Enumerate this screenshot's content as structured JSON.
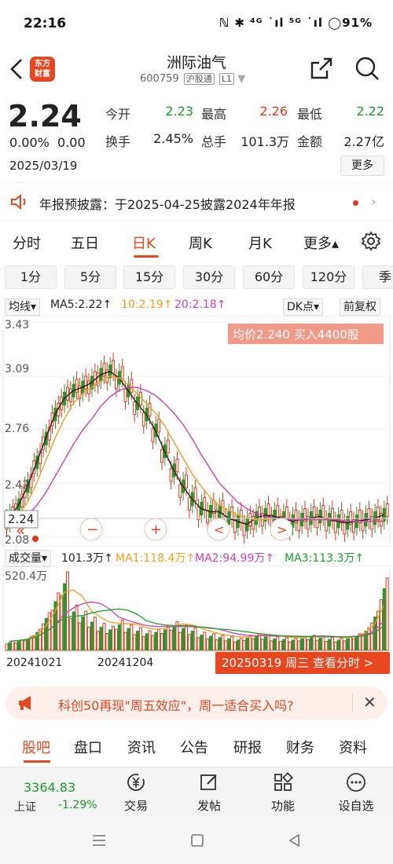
{
  "status": {
    "time": "22:16",
    "battery": "91%",
    "icons": "ℕ ✱ ⁴ᴳ ˙ıl ⁵ᴳ ˙ıl"
  },
  "header": {
    "logo_line1": "东方",
    "logo_line2": "财富",
    "name": "洲际油气",
    "code": "600759",
    "tag1": "沪股通",
    "tag2": "L1"
  },
  "quote": {
    "price": "2.24",
    "change_pct": "0.00%",
    "change": "0.00",
    "date": "2025/03/19",
    "fields": [
      {
        "label": "今开",
        "value": "2.23",
        "color": "#19a02a"
      },
      {
        "label": "最高",
        "value": "2.26",
        "color": "#e8341c"
      },
      {
        "label": "最低",
        "value": "2.22",
        "color": "#19a02a"
      },
      {
        "label": "换手",
        "value": "2.45%",
        "color": "#222222"
      },
      {
        "label": "总手",
        "value": "101.3万",
        "color": "#222222"
      },
      {
        "label": "金额",
        "value": "2.27亿",
        "color": "#222222"
      }
    ],
    "more_label": "更多"
  },
  "notice": {
    "text": "年报预披露：于2025-04-25披露2024年年报",
    "arrow": "›"
  },
  "tabs": [
    "分时",
    "五日",
    "日K",
    "周K",
    "月K",
    "更多▴"
  ],
  "active_tab": "日K",
  "periods": [
    "1分",
    "5分",
    "15分",
    "30分",
    "60分",
    "120分",
    "季"
  ],
  "chart_header": {
    "ma_label": "均线▾",
    "ma5": "MA5:2.22↑",
    "ma10": "10:2.19↑",
    "ma20": "20:2.18↑",
    "dk_label": "DK点▾",
    "adj_label": "前复权"
  },
  "chart_axis": {
    "y_top": "3.43",
    "y_2": "3.09",
    "y_3": "2.76",
    "y_4": "2.42",
    "y_5": "2.08",
    "current": "2.24",
    "avg_tip": "均价2.240  买入4400股"
  },
  "vol_header": {
    "label": "成交量▾",
    "vol": "101.3万↑",
    "ma1": "MA1:118.4万↑",
    "ma2": "MA2:94.99万↑",
    "ma3": "MA3:113.3万↑",
    "max": "520.4万"
  },
  "bottom_dates": {
    "d1": "20241021",
    "d2": "20241204",
    "hint": "20250319 周三 查看分时 >"
  },
  "promo": {
    "text": "科创50再现\"周五效应\"，周一适合买入吗?"
  },
  "ftabs": [
    "股吧",
    "盘口",
    "资讯",
    "公告",
    "研报",
    "财务",
    "资料"
  ],
  "botnav": {
    "idx_val": "3364.83",
    "idx_name": "上证",
    "idx_pct": "-1.29%",
    "items": [
      "交易",
      "发帖",
      "功能",
      "设自选"
    ]
  },
  "colors": {
    "accent": "#e8461f",
    "up": "#e8341c",
    "down": "#19a02a",
    "ma5": "#222222",
    "ma10": "#f0a020",
    "ma20": "#d040b0"
  },
  "chart_data": {
    "type": "candlestick",
    "title": "",
    "ylim": [
      2.08,
      3.43
    ],
    "x_labels": [
      "20241021",
      "20241204",
      "20250319"
    ],
    "candles_note": "daily K-line, 2024-10 to 2025-03",
    "series": [
      {
        "name": "MA5",
        "values": [
          2.2,
          2.28,
          2.4,
          2.55,
          2.7,
          2.85,
          2.95,
          3.0,
          3.02,
          3.05,
          3.1,
          3.12,
          3.08,
          3.0,
          2.92,
          2.85,
          2.75,
          2.62,
          2.5,
          2.4,
          2.32,
          2.26,
          2.24,
          2.24,
          2.2,
          2.18,
          2.16,
          2.2,
          2.22,
          2.21,
          2.2,
          2.18,
          2.19,
          2.2,
          2.21,
          2.19,
          2.18,
          2.17,
          2.18,
          2.19,
          2.2,
          2.22
        ]
      },
      {
        "name": "MA10",
        "values": [
          2.18,
          2.22,
          2.3,
          2.42,
          2.56,
          2.7,
          2.82,
          2.92,
          2.98,
          3.02,
          3.06,
          3.09,
          3.08,
          3.04,
          2.98,
          2.92,
          2.86,
          2.78,
          2.68,
          2.58,
          2.48,
          2.4,
          2.33,
          2.28,
          2.25,
          2.22,
          2.2,
          2.19,
          2.19,
          2.2,
          2.2,
          2.19,
          2.19,
          2.19,
          2.2,
          2.2,
          2.19,
          2.18,
          2.18,
          2.18,
          2.18,
          2.19
        ]
      },
      {
        "name": "MA20",
        "values": [
          2.16,
          2.18,
          2.22,
          2.28,
          2.36,
          2.46,
          2.56,
          2.66,
          2.75,
          2.82,
          2.9,
          2.96,
          3.0,
          3.02,
          3.02,
          3.0,
          2.97,
          2.92,
          2.86,
          2.79,
          2.7,
          2.6,
          2.51,
          2.42,
          2.36,
          2.3,
          2.26,
          2.23,
          2.21,
          2.2,
          2.2,
          2.19,
          2.19,
          2.19,
          2.19,
          2.19,
          2.19,
          2.18,
          2.18,
          2.18,
          2.18,
          2.18
        ]
      }
    ],
    "volume_max": 520.4,
    "volume": [
      60,
      70,
      90,
      140,
      250,
      380,
      520,
      300,
      260,
      220,
      180,
      160,
      200,
      170,
      150,
      130,
      140,
      160,
      190,
      170,
      150,
      120,
      110,
      100,
      90,
      80,
      95,
      110,
      105,
      90,
      85,
      80,
      90,
      100,
      95,
      85,
      80,
      90,
      110,
      150,
      260,
      480
    ]
  }
}
